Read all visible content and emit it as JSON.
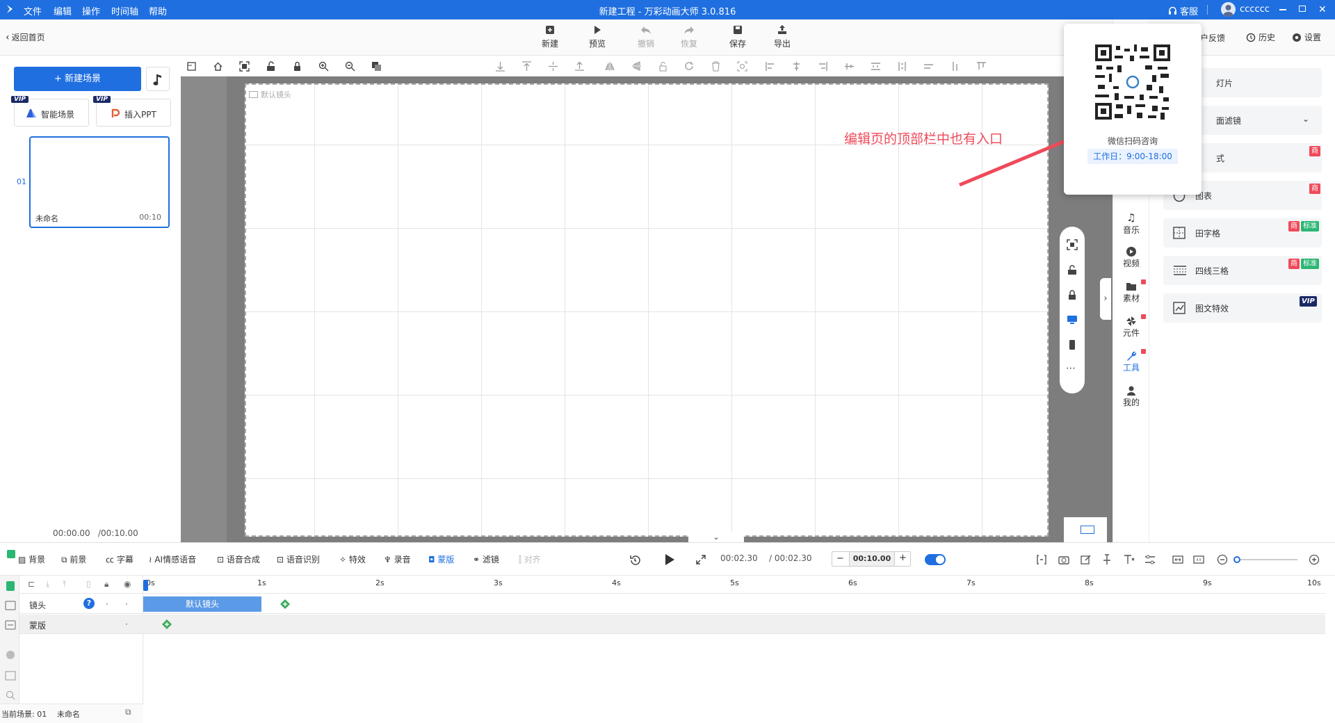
{
  "titlebar": {
    "menus": [
      "文件",
      "编辑",
      "操作",
      "时间轴",
      "帮助"
    ],
    "title": "新建工程 - 万彩动画大师 3.0.816",
    "support": "客服",
    "user": "cccccc"
  },
  "toolbar": {
    "back": "返回首页",
    "new": "新建",
    "preview": "预览",
    "undo": "撤销",
    "redo": "恢复",
    "save": "保存",
    "export": "导出",
    "feedback": "户反馈",
    "history": "历史",
    "settings": "设置"
  },
  "left": {
    "new_scene": "+ 新建场景",
    "smart_scene": "智能场景",
    "insert_ppt": "插入PPT",
    "vip": "VIP",
    "scene_no": "01",
    "scene_name": "未命名",
    "scene_dur": "00:10",
    "time_cur": "00:00.00",
    "time_total": "/00:10.00"
  },
  "canvas": {
    "camera_label": "默认镜头",
    "annotation": "编辑页的顶部栏中也有入口"
  },
  "popup": {
    "caption": "微信扫码咨询",
    "hours": "工作日：9:00-18:00"
  },
  "rightnav": {
    "items": [
      "音乐",
      "视频",
      "素材",
      "元件",
      "工具",
      "我的"
    ]
  },
  "rightpanel": {
    "cards": [
      "灯片",
      "面滤镜",
      "式",
      "图表",
      "田字格",
      "四线三格",
      "图文特效"
    ],
    "badge_shang": "商",
    "badge_std": "标准",
    "badge_vip": "VIP"
  },
  "bottom": {
    "tabs": [
      "背景",
      "前景",
      "字幕",
      "AI情感语音",
      "语音合成",
      "语音识别",
      "特效",
      "录音",
      "蒙版",
      "滤镜",
      "对齐"
    ],
    "time_now": "00:02.30",
    "time_total": "/ 00:02.30",
    "duration": "00:10.00",
    "minus": "−",
    "plus": "+"
  },
  "timeline": {
    "ticks": [
      "0s",
      "1s",
      "2s",
      "3s",
      "4s",
      "5s",
      "6s",
      "7s",
      "8s",
      "9s",
      "10s"
    ],
    "tracks": [
      "镜头",
      "蒙版"
    ],
    "clip": "默认镜头",
    "status_label": "当前场景: 01",
    "status_name": "未命名"
  }
}
